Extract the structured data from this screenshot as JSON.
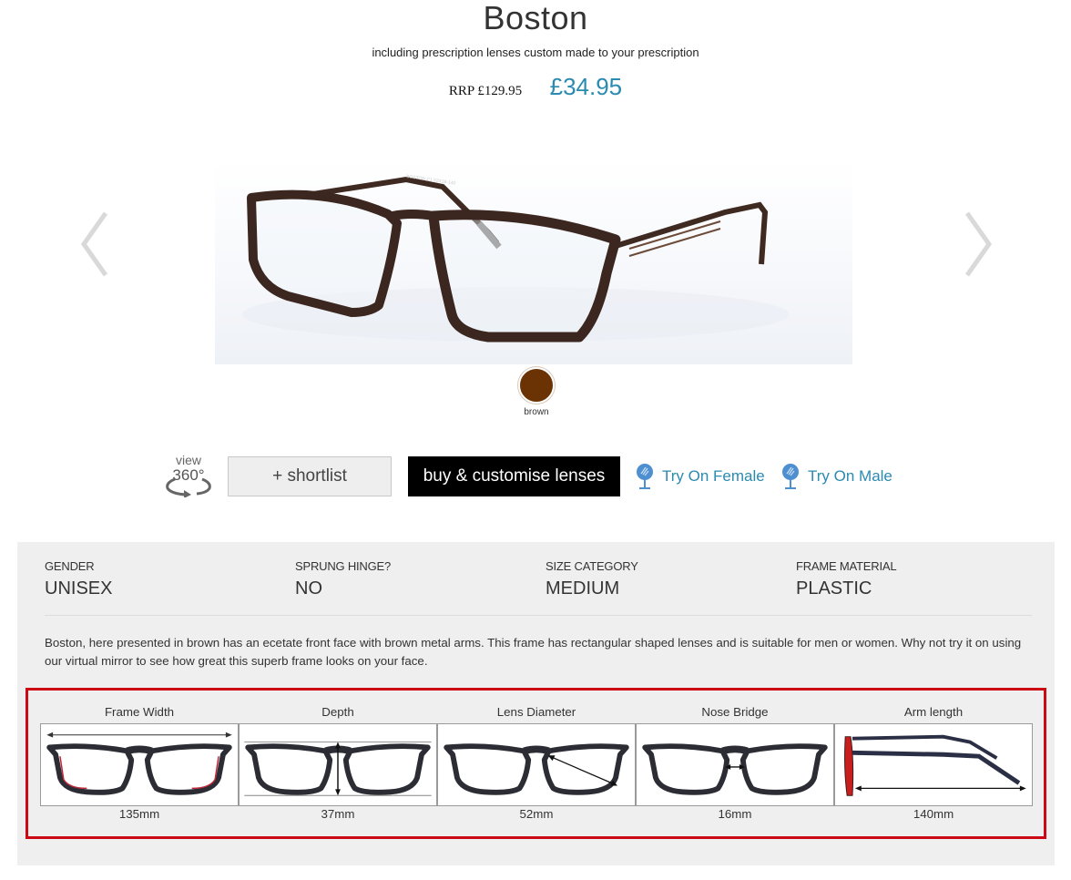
{
  "product": {
    "title": "Boston",
    "subtitle": "including prescription lenses custom made to your prescription",
    "rrp": "RRP £129.95",
    "price": "£34.95",
    "price_color": "#2b8ab0"
  },
  "gallery": {
    "prev_icon": "chevron-left-icon",
    "next_icon": "chevron-right-icon",
    "image_alt": "Boston brown glasses"
  },
  "colors": [
    {
      "name": "brown",
      "hex": "#6b3304",
      "selected": true
    }
  ],
  "actions": {
    "view360_top": "view",
    "view360_main": "360°",
    "shortlist_label": "+ shortlist",
    "buy_label": "buy & customise lenses",
    "try_on_female": "Try On Female",
    "try_on_male": "Try On Male"
  },
  "specs": [
    {
      "label": "GENDER",
      "value": "UNISEX"
    },
    {
      "label": "SPRUNG HINGE?",
      "value": "NO"
    },
    {
      "label": "SIZE CATEGORY",
      "value": "MEDIUM"
    },
    {
      "label": "FRAME MATERIAL",
      "value": "PLASTIC"
    }
  ],
  "description": "Boston, here presented in brown has an ecetate front face with brown metal arms. This frame has rectangular shaped lenses and is suitable for men or women. Why not try it on using our virtual mirror to see how great this superb frame looks on your face.",
  "measurements": [
    {
      "label": "Frame Width",
      "value": "135mm"
    },
    {
      "label": "Depth",
      "value": "37mm"
    },
    {
      "label": "Lens Diameter",
      "value": "52mm"
    },
    {
      "label": "Nose Bridge",
      "value": "16mm"
    },
    {
      "label": "Arm length",
      "value": "140mm"
    }
  ],
  "highlight_color": "#cc0a14"
}
